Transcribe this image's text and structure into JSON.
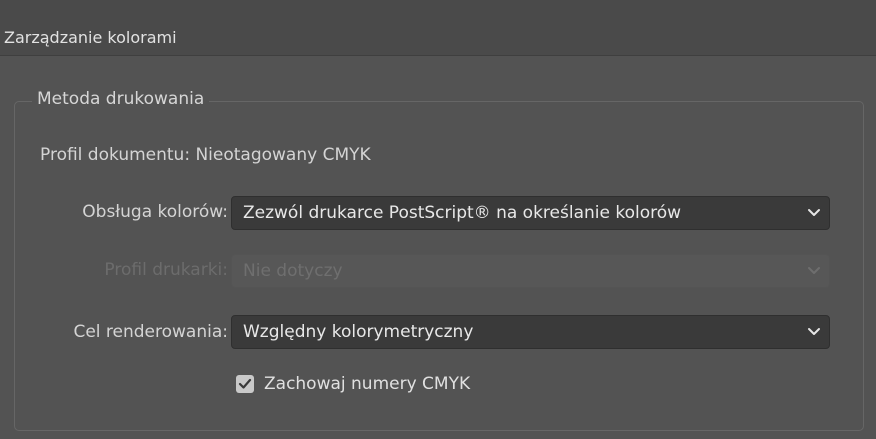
{
  "window": {
    "title": "Zarządzanie kolorami"
  },
  "print_method": {
    "legend": "Metoda drukowania",
    "document_profile": "Profil dokumentu: Nieotagowany CMYK",
    "color_handling": {
      "label": "Obsługa kolorów:",
      "value": "Zezwól drukarce PostScript® na określanie kolorów"
    },
    "printer_profile": {
      "label": "Profil drukarki:",
      "value": "Nie dotyczy",
      "disabled": true
    },
    "rendering_intent": {
      "label": "Cel renderowania:",
      "value": "Względny kolorymetryczny"
    },
    "preserve_cmyk": {
      "label": "Zachowaj numery CMYK",
      "checked": true
    }
  },
  "icons": {
    "dropdown": "chevron-down-icon",
    "check": "check-icon"
  }
}
